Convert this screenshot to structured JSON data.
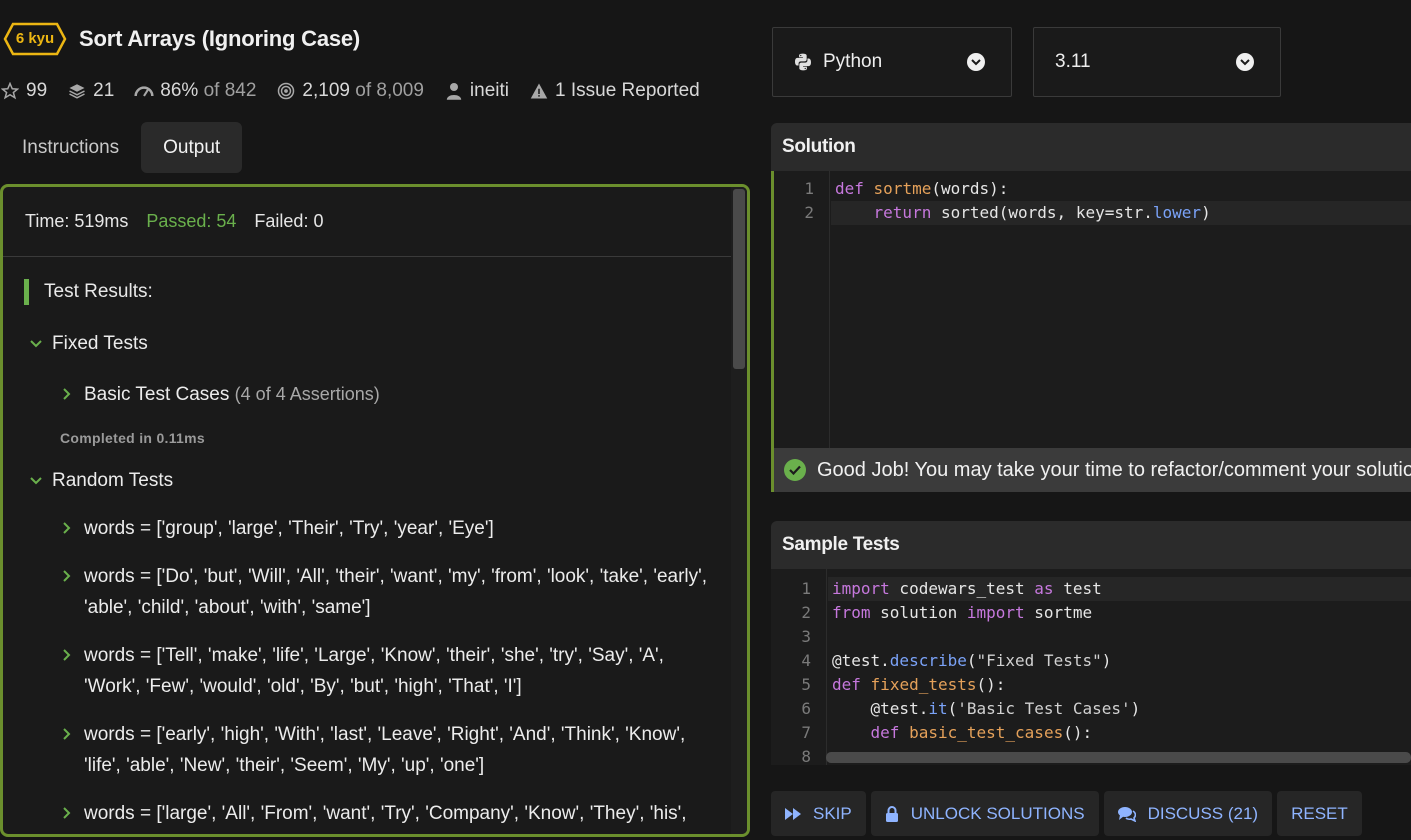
{
  "kata": {
    "rank": "6 kyu",
    "title": "Sort Arrays (Ignoring Case)",
    "stars": "99",
    "collections": "21",
    "satisfaction_pct": "86%",
    "satisfaction_of": "of 842",
    "completed": "2,109",
    "completed_of": "of 8,009",
    "author": "ineiti",
    "issues": "1 Issue Reported"
  },
  "tabs": [
    "Instructions",
    "Output"
  ],
  "output": {
    "time": "Time: 519ms",
    "passed": "Passed: 54",
    "failed": "Failed: 0",
    "results_heading": "Test Results:",
    "fixed_group": "Fixed Tests",
    "basic_case": "Basic Test Cases",
    "basic_asserts": "(4 of 4 Assertions)",
    "completed_in": "Completed in 0.11ms",
    "random_group": "Random Tests",
    "cases": [
      "words = ['group', 'large', 'Their', 'Try', 'year', 'Eye']",
      "words = ['Do', 'but', 'Will', 'All', 'their', 'want', 'my', 'from', 'look', 'take', 'early', 'able', 'child', 'about', 'with', 'same']",
      "words = ['Tell', 'make', 'life', 'Large', 'Know', 'their', 'she', 'try', 'Say', 'A', 'Work', 'Few', 'would', 'old', 'By', 'but', 'high', 'That', 'I']",
      "words = ['early', 'high', 'With', 'last', 'Leave', 'Right', 'And', 'Think', 'Know', 'life', 'able', 'New', 'their', 'Seem', 'My', 'up', 'one']",
      "words = ['large', 'All', 'From', 'want', 'Try', 'Company', 'Know', 'They', 'his',"
    ]
  },
  "language": {
    "selected": "Python",
    "version": "3.11"
  },
  "solution": {
    "heading": "Solution",
    "line_numbers": [
      "1",
      "2"
    ],
    "banner": "Good Job! You may take your time to refactor/comment your solution"
  },
  "sample_tests": {
    "heading": "Sample Tests",
    "line_numbers": [
      "1",
      "2",
      "3",
      "4",
      "5",
      "6",
      "7",
      "8"
    ]
  },
  "actions": {
    "skip": "SKIP",
    "unlock": "UNLOCK SOLUTIONS",
    "discuss": "DISCUSS (21)",
    "reset": "RESET"
  },
  "colors": {
    "accent_green": "#6ab04c",
    "rank_yellow": "#ecb613",
    "link_blue": "#8fb4ff",
    "border_green": "#6b8f2d"
  },
  "icons": [
    "star-icon",
    "layers-icon",
    "gauge-icon",
    "target-icon",
    "user-icon",
    "warning-icon",
    "python-icon",
    "check-circle-icon",
    "fast-forward-icon",
    "lock-icon",
    "comments-icon"
  ]
}
